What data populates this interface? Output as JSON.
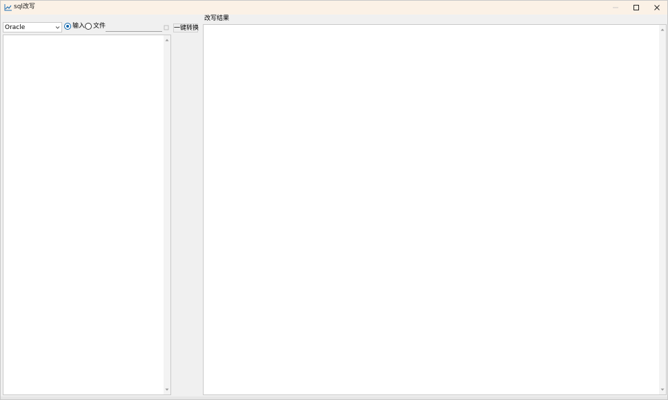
{
  "window": {
    "title": "sql改写",
    "icon": "chart-line-icon",
    "controls": [
      "minimize-icon",
      "maximize-icon",
      "close-icon"
    ]
  },
  "left_panel": {
    "database_select": {
      "value": "Oracle"
    },
    "source_options": [
      {
        "label": "输入",
        "checked": true
      },
      {
        "label": "文件",
        "checked": false
      }
    ],
    "file_path": {
      "value": ""
    },
    "input_text": ""
  },
  "toolbar": {
    "convert_label": "一键转换"
  },
  "right_panel": {
    "result_label": "改写结果",
    "result_text": ""
  },
  "colors": {
    "titlebar": "#fbf1e6",
    "window_bg": "#f0f0f0",
    "accent": "#0a64ad"
  }
}
